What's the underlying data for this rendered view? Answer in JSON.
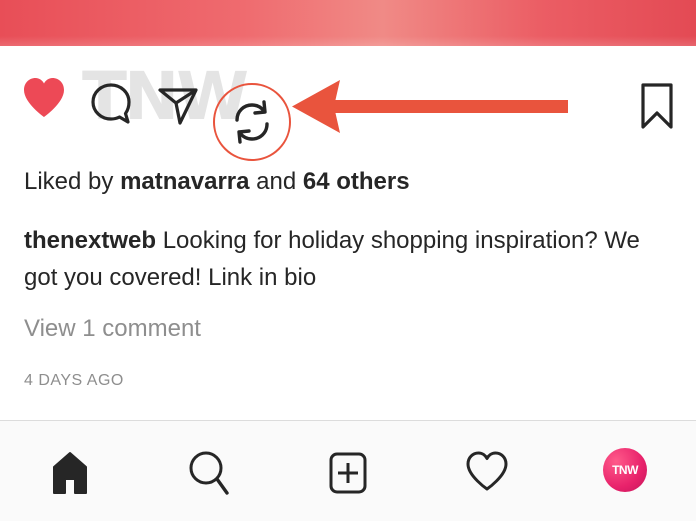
{
  "post": {
    "watermark": "TNW",
    "likes": {
      "prefix": "Liked by ",
      "user": "matnavarra",
      "middle": " and ",
      "others": "64 others"
    },
    "caption": {
      "username": "thenextweb",
      "text": " Looking for holiday shopping inspiration? We got you covered! Link in bio"
    },
    "view_comments": "View 1 comment",
    "timestamp": "4 DAYS AGO"
  },
  "icons": {
    "like": "heart-filled-icon",
    "comment": "comment-icon",
    "direct": "paper-plane-icon",
    "share": "refresh-share-icon",
    "pointer": "arrow-left-icon",
    "save": "bookmark-icon"
  },
  "tabs": {
    "home": "home-icon",
    "search": "search-icon",
    "new_post": "plus-square-icon",
    "activity": "heart-outline-icon",
    "profile_avatar_text": "TNW"
  },
  "colors": {
    "like_red": "#ed4956",
    "annotation_orange": "#e9543d",
    "text_dark": "#262626",
    "text_muted": "#8e8e8e"
  }
}
